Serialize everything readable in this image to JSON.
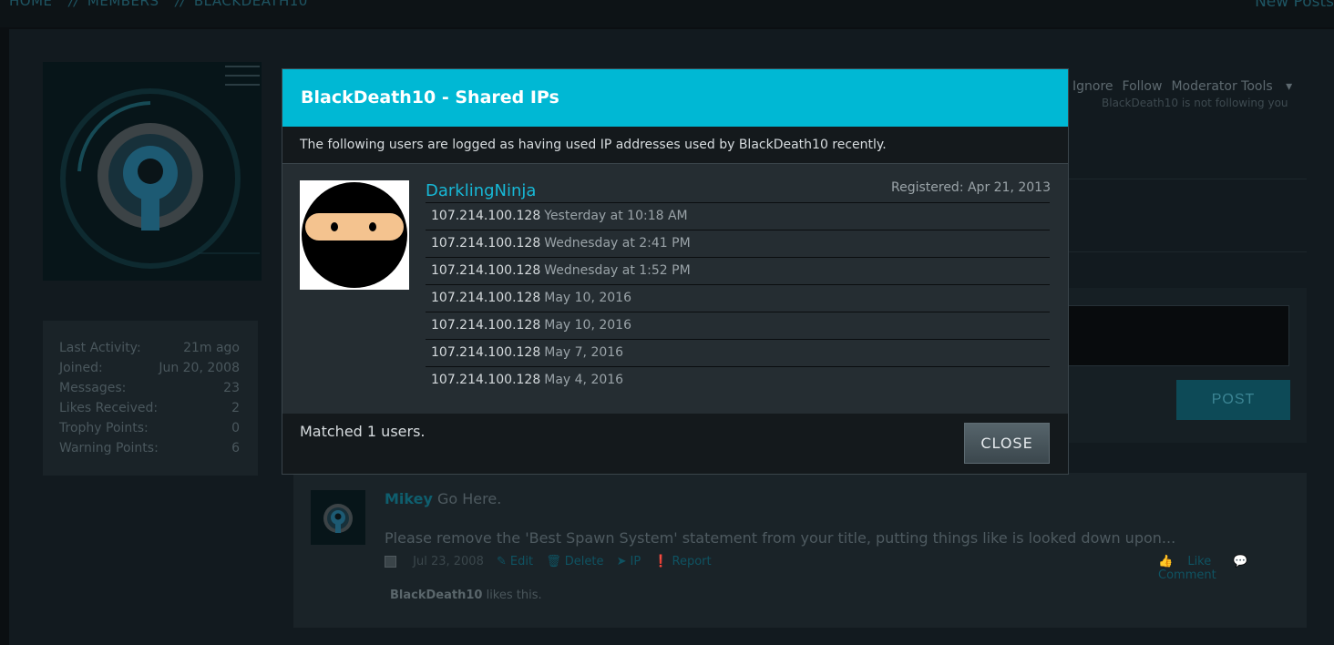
{
  "breadcrumbs": [
    "HOME",
    "MEMBERS",
    "BLACKDEATH10"
  ],
  "new_posts": "New Posts",
  "profile_actions": {
    "ignore": "Ignore",
    "follow": "Follow",
    "moderator_tools": "Moderator Tools",
    "follow_note": "BlackDeath10 is not following you"
  },
  "stats": [
    {
      "label": "Last Activity:",
      "value": "21m ago"
    },
    {
      "label": "Joined:",
      "value": "Jun 20, 2008"
    },
    {
      "label": "Messages:",
      "value": "23"
    },
    {
      "label": "Likes Received:",
      "value": "2"
    },
    {
      "label": "Trophy Points:",
      "value": "0"
    },
    {
      "label": "Warning Points:",
      "value": "6"
    }
  ],
  "reply": {
    "post_label": "POST"
  },
  "message": {
    "author": "Mikey",
    "headline": "Go Here.",
    "body": "Please remove the 'Best Spawn System' statement from your title, putting things like is looked down upon...",
    "date": "Jul 23, 2008",
    "edit": "Edit",
    "delete": "Delete",
    "ip": "IP",
    "report": "Report",
    "like": "Like",
    "comment": "Comment",
    "likes_user": "BlackDeath10",
    "likes_suffix": "likes this."
  },
  "modal": {
    "title": "BlackDeath10 - Shared IPs",
    "description": "The following users are logged as having used IP addresses used by BlackDeath10 recently.",
    "user": {
      "name": "DarklingNinja",
      "registered": "Registered: Apr 21, 2013"
    },
    "ips": [
      {
        "ip": "107.214.100.128",
        "when": "Yesterday at 10:18 AM"
      },
      {
        "ip": "107.214.100.128",
        "when": "Wednesday at 2:41 PM"
      },
      {
        "ip": "107.214.100.128",
        "when": "Wednesday at 1:52 PM"
      },
      {
        "ip": "107.214.100.128",
        "when": "May 10, 2016"
      },
      {
        "ip": "107.214.100.128",
        "when": "May 10, 2016"
      },
      {
        "ip": "107.214.100.128",
        "when": "May 7, 2016"
      },
      {
        "ip": "107.214.100.128",
        "when": "May 4, 2016"
      }
    ],
    "matched": "Matched 1 users.",
    "close_label": "CLOSE"
  },
  "colors": {
    "accent": "#00b8d4",
    "link": "#17b8d6",
    "modal_bg": "#252d32"
  }
}
